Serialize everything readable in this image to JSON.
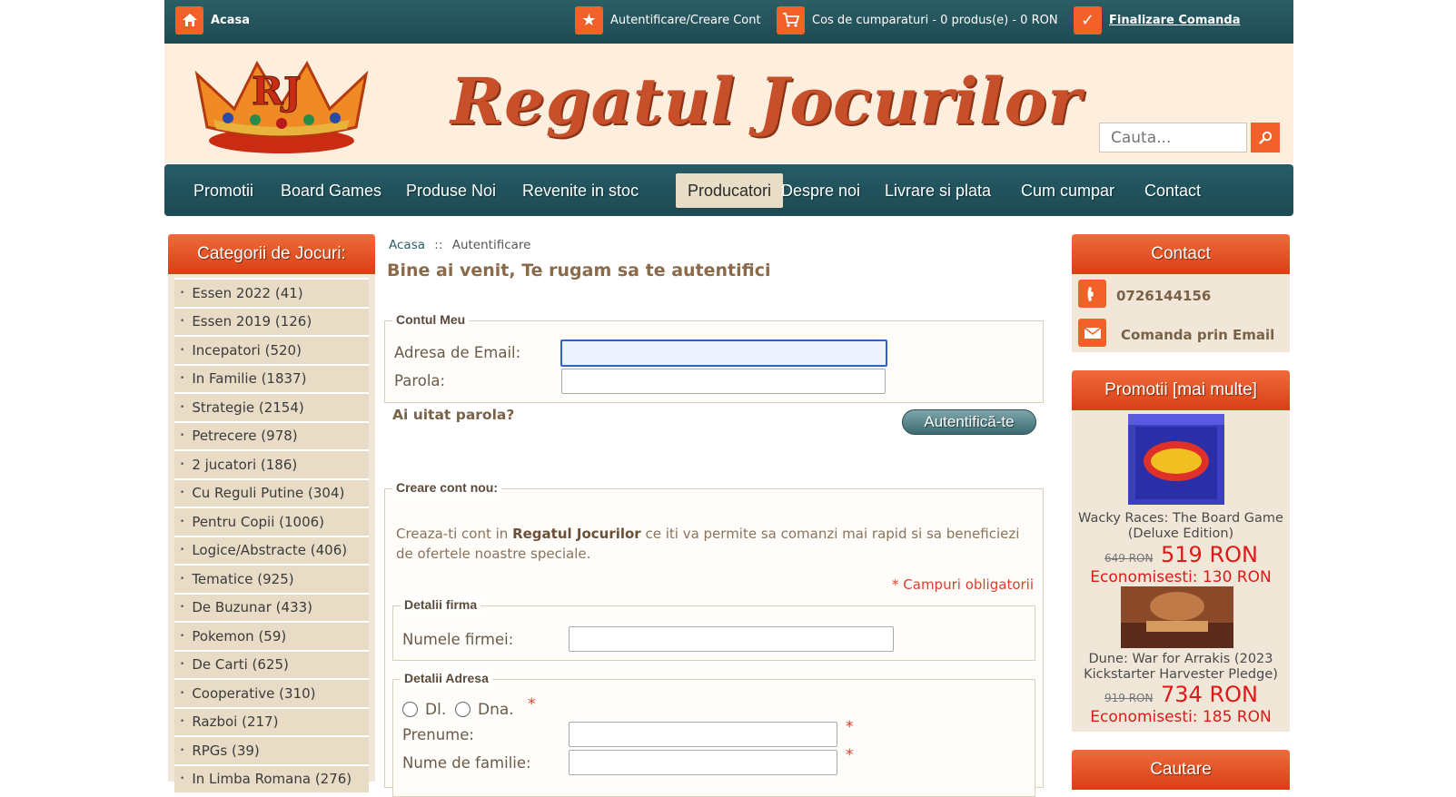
{
  "topbar": {
    "home": "Acasa",
    "account": "Autentificare/Creare Cont",
    "cart": "Cos de cumparaturi - 0 produs(e) - 0 RON",
    "checkout": "Finalizare Comanda"
  },
  "header": {
    "logo_text": "Regatul Jocurilor",
    "logo_crown_letters": "RJ",
    "search_placeholder": "Cauta..."
  },
  "nav": {
    "items": [
      "Promotii",
      "Board Games",
      "Produse Noi",
      "Revenite in stoc",
      "Producatori",
      "Despre noi",
      "Livrare si plata",
      "Cum cumpar",
      "Contact"
    ],
    "active": "Producatori"
  },
  "left": {
    "title": "Categorii de Jocuri:",
    "categories": [
      "Essen 2022 (41)",
      "Essen 2019 (126)",
      "Incepatori (520)",
      "In Familie (1837)",
      "Strategie (2154)",
      "Petrecere (978)",
      "2 jucatori (186)",
      "Cu Reguli Putine (304)",
      "Pentru Copii (1006)",
      "Logice/Abstracte (406)",
      "Tematice (925)",
      "De Buzunar (433)",
      "Pokemon (59)",
      "De Carti (625)",
      "Cooperative (310)",
      "Razboi (217)",
      "RPGs (39)",
      "In Limba Romana (276)"
    ]
  },
  "main": {
    "breadcrumb_home": "Acasa",
    "breadcrumb_sep": "::",
    "breadcrumb_current": "Autentificare",
    "title": "Bine ai venit, Te rugam sa te autentifici",
    "login": {
      "legend": "Contul Meu",
      "email_label": "Adresa de Email:",
      "password_label": "Parola:",
      "forgot": "Ai uitat parola?",
      "submit": "Autentifică-te"
    },
    "register": {
      "legend": "Creare cont nou:",
      "intro_before": "Creaza-ti cont in ",
      "intro_brand": "Regatul Jocurilor",
      "intro_after": " ce iti va permite sa comanzi mai rapid si sa beneficiezi de ofertele noastre speciale.",
      "required_note": "* Campuri obligatorii",
      "company_legend": "Detalii firma",
      "company_label": "Numele firmei:",
      "address_legend": "Detalii Adresa",
      "salutation_mr": "Dl.",
      "salutation_mrs": "Dna.",
      "firstname_label": "Prenume:",
      "lastname_label": "Nume de familie:",
      "required_mark": "*"
    }
  },
  "right": {
    "contact_title": "Contact",
    "phone": "0726144156",
    "email_order": "Comanda prin Email",
    "promo_title": "Promotii  [mai multe]",
    "promos": [
      {
        "name": "Wacky Races: The Board Game (Deluxe Edition)",
        "old_price": "649 RON",
        "new_price": "519 RON",
        "savings": "Economisesti: 130 RON"
      },
      {
        "name": "Dune: War for Arrakis (2023 Kickstarter Harvester Pledge)",
        "old_price": "919 RON",
        "new_price": "734 RON",
        "savings": "Economisesti: 185 RON"
      }
    ],
    "search_title": "Cautare"
  },
  "colors": {
    "teal": "#265c66",
    "orange": "#f2612a",
    "beige": "#f0e7d8",
    "red_price": "#e01818"
  }
}
